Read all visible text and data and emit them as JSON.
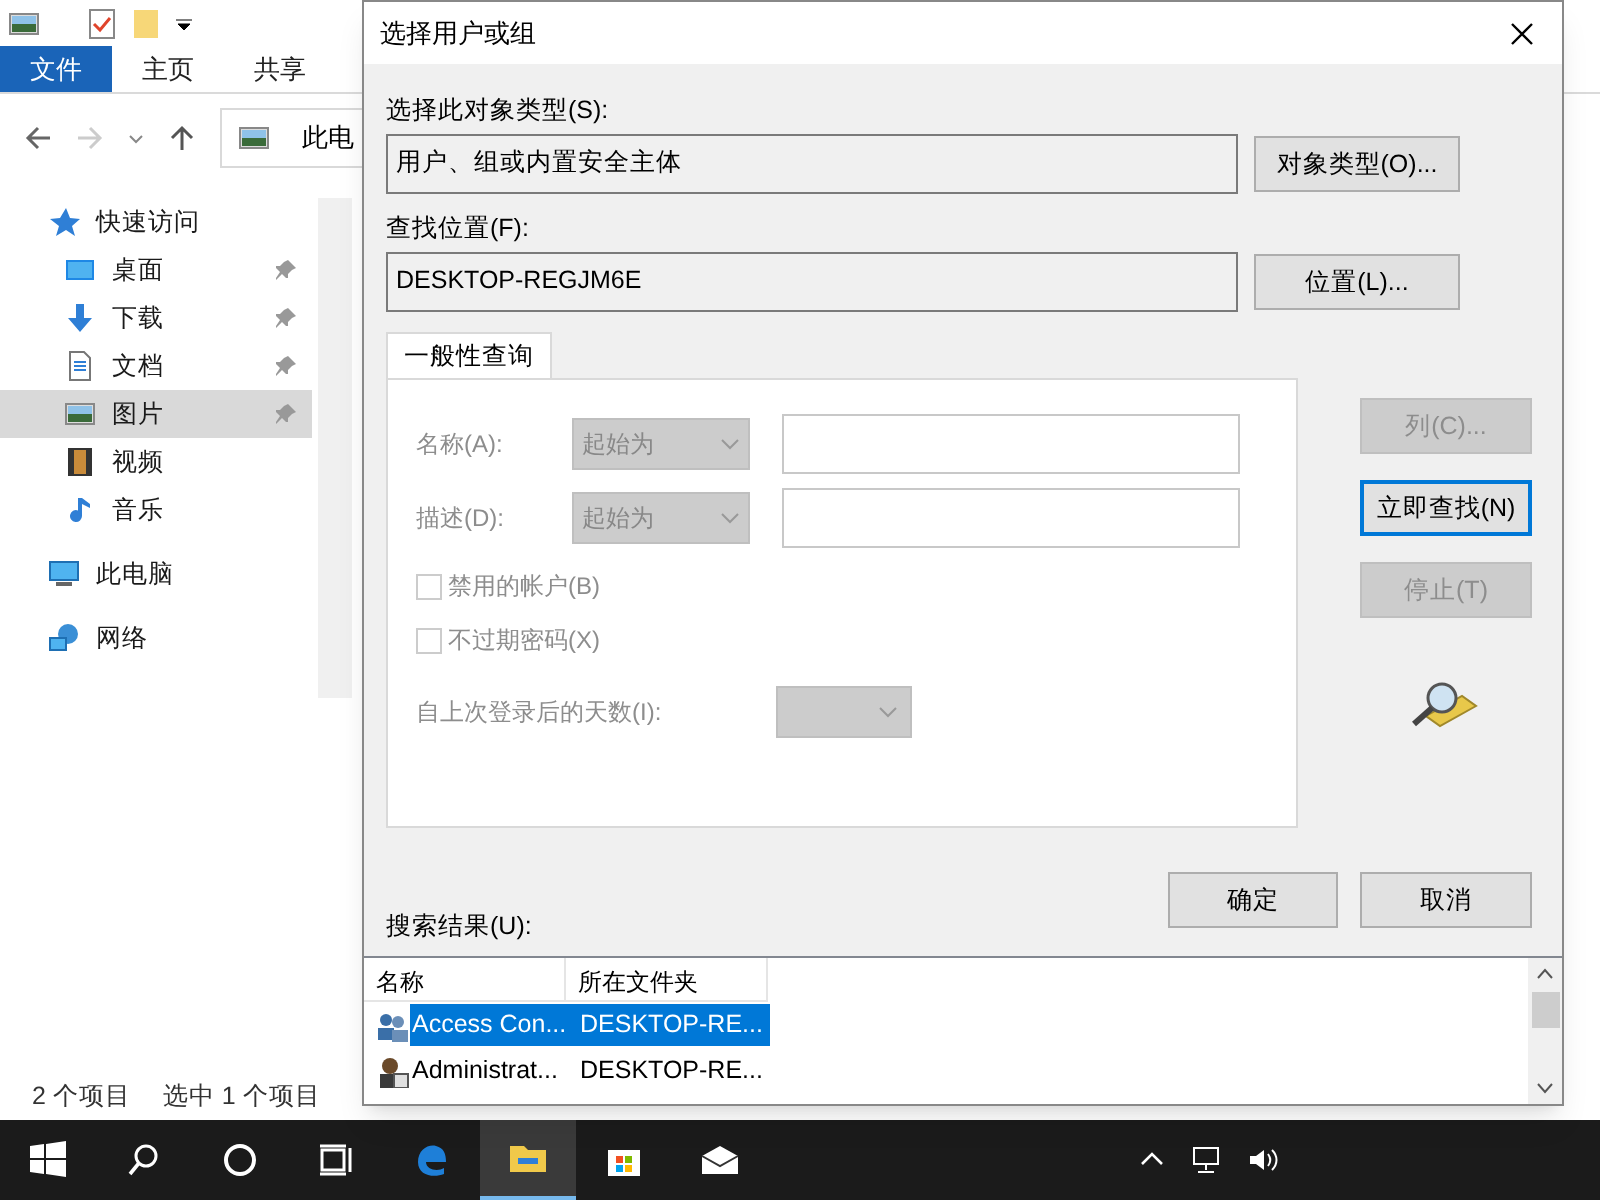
{
  "explorer": {
    "ribbon_tabs": [
      {
        "label": "文件",
        "selected": true
      },
      {
        "label": "主页",
        "selected": false
      },
      {
        "label": "共享",
        "selected": false
      }
    ],
    "address": "此电",
    "nav": [
      {
        "label": "快速访问",
        "kind": "star",
        "selected": false,
        "pinned": false,
        "children": [
          {
            "label": "桌面",
            "kind": "desktop",
            "selected": false,
            "pinned": true
          },
          {
            "label": "下载",
            "kind": "download",
            "selected": false,
            "pinned": true
          },
          {
            "label": "文档",
            "kind": "document",
            "selected": false,
            "pinned": true
          },
          {
            "label": "图片",
            "kind": "picture",
            "selected": true,
            "pinned": true
          },
          {
            "label": "视频",
            "kind": "video",
            "selected": false,
            "pinned": false
          },
          {
            "label": "音乐",
            "kind": "music",
            "selected": false,
            "pinned": false
          }
        ]
      },
      {
        "label": "此电脑",
        "kind": "computer",
        "selected": false,
        "pinned": false
      },
      {
        "label": "网络",
        "kind": "network",
        "selected": false,
        "pinned": false
      }
    ],
    "status": [
      "2 个项目",
      "选中 1 个项目"
    ]
  },
  "dialog": {
    "title": "选择用户或组",
    "object_type": {
      "label": "选择此对象类型(S):",
      "value": "用户、组或内置安全主体",
      "button": "对象类型(O)..."
    },
    "location": {
      "label": "查找位置(F):",
      "value": "DESKTOP-REGJM6E",
      "button": "位置(L)..."
    },
    "tabs": [
      {
        "label": "一般性查询",
        "selected": true
      }
    ],
    "fields": [
      {
        "label": "名称(A):",
        "mode": "起始为",
        "disabled": true
      },
      {
        "label": "描述(D):",
        "mode": "起始为",
        "disabled": true
      }
    ],
    "checkboxes": [
      {
        "label": "禁用的帐户(B)",
        "checked": false,
        "disabled": true
      },
      {
        "label": "不过期密码(X)",
        "checked": false,
        "disabled": true
      }
    ],
    "days": {
      "label": "自上次登录后的天数(I):",
      "disabled": true
    },
    "side_buttons": [
      {
        "label": "列(C)...",
        "disabled": true,
        "focused": false
      },
      {
        "label": "立即查找(N)",
        "disabled": false,
        "focused": true
      },
      {
        "label": "停止(T)",
        "disabled": true,
        "focused": false
      }
    ],
    "ok": "确定",
    "cancel": "取消",
    "results": {
      "label": "搜索结果(U):",
      "columns": [
        "名称",
        "所在文件夹"
      ],
      "rows": [
        {
          "name": "Access Con...",
          "folder": "DESKTOP-RE...",
          "kind": "group",
          "selected": true
        },
        {
          "name": "Administrat...",
          "folder": "DESKTOP-RE...",
          "kind": "user",
          "selected": false
        }
      ]
    }
  },
  "taskbar": {
    "apps": [
      {
        "kind": "start",
        "selected": false
      },
      {
        "kind": "search",
        "selected": false
      },
      {
        "kind": "cortana",
        "selected": false
      },
      {
        "kind": "taskview",
        "selected": false
      },
      {
        "kind": "edge",
        "selected": false
      },
      {
        "kind": "explorer",
        "selected": true
      },
      {
        "kind": "store",
        "selected": false
      },
      {
        "kind": "mail",
        "selected": false
      }
    ],
    "tray": [
      {
        "kind": "chevron"
      },
      {
        "kind": "network"
      },
      {
        "kind": "volume"
      }
    ]
  }
}
